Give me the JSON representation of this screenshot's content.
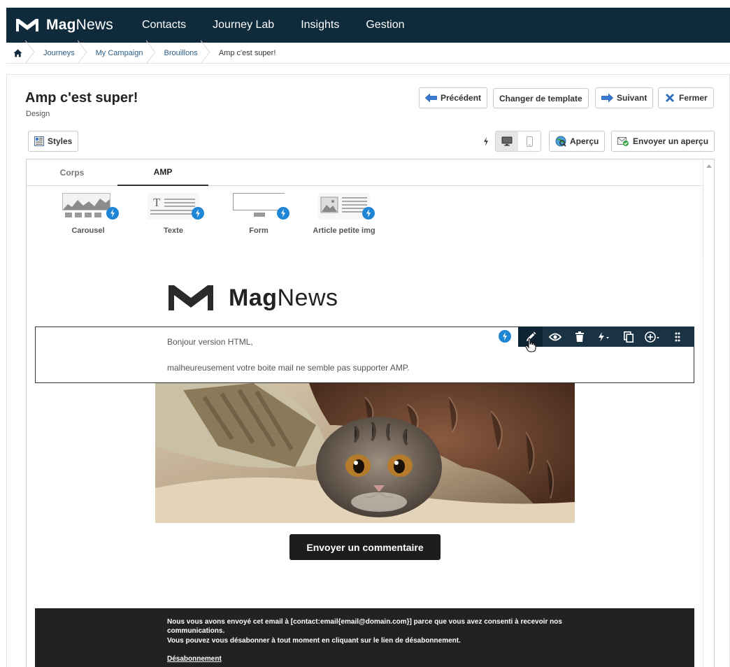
{
  "brand": {
    "name_bold": "Mag",
    "name_rest": "News"
  },
  "nav": {
    "items": [
      {
        "label": "Contacts"
      },
      {
        "label": "Journey Lab"
      },
      {
        "label": "Insights"
      },
      {
        "label": "Gestion"
      }
    ]
  },
  "breadcrumb": {
    "items": [
      "Journeys",
      "My Campaign",
      "Brouillons"
    ],
    "current": "Amp c'est super!"
  },
  "page": {
    "title": "Amp c'est super!",
    "subtitle": "Design"
  },
  "actions": {
    "previous": "Précédent",
    "change_template": "Changer de template",
    "next": "Suivant",
    "close": "Fermer",
    "styles": "Styles",
    "preview": "Aperçu",
    "send_preview": "Envoyer un aperçu"
  },
  "tabs": [
    {
      "label": "Corps"
    },
    {
      "label": "AMP"
    }
  ],
  "blocks": [
    {
      "label": "Carousel"
    },
    {
      "label": "Texte"
    },
    {
      "label": "Form"
    },
    {
      "label": "Article petite img"
    }
  ],
  "email": {
    "logo_bold": "Mag",
    "logo_rest": "News",
    "text_line1": "Bonjour version HTML,",
    "text_line2": "malheureusement votre boite mail ne semble pas supporter AMP.",
    "cta": "Envoyer un commentaire",
    "footer_line1": "Nous vous avons envoyé cet email à [contact:email{email@domain.com}] parce que vous avez consenti à recevoir nos communications.",
    "footer_line2": "Vous pouvez vous désabonner à tout moment en cliquant sur le lien de désabonnement.",
    "unsubscribe": "Désabonnement"
  },
  "colors": {
    "nav_bg": "#0e2a3b",
    "amp_blue": "#1f86d6",
    "toolbar_bg": "#193244",
    "cta_bg": "#1d1d1d",
    "footer_bg": "#222222"
  }
}
